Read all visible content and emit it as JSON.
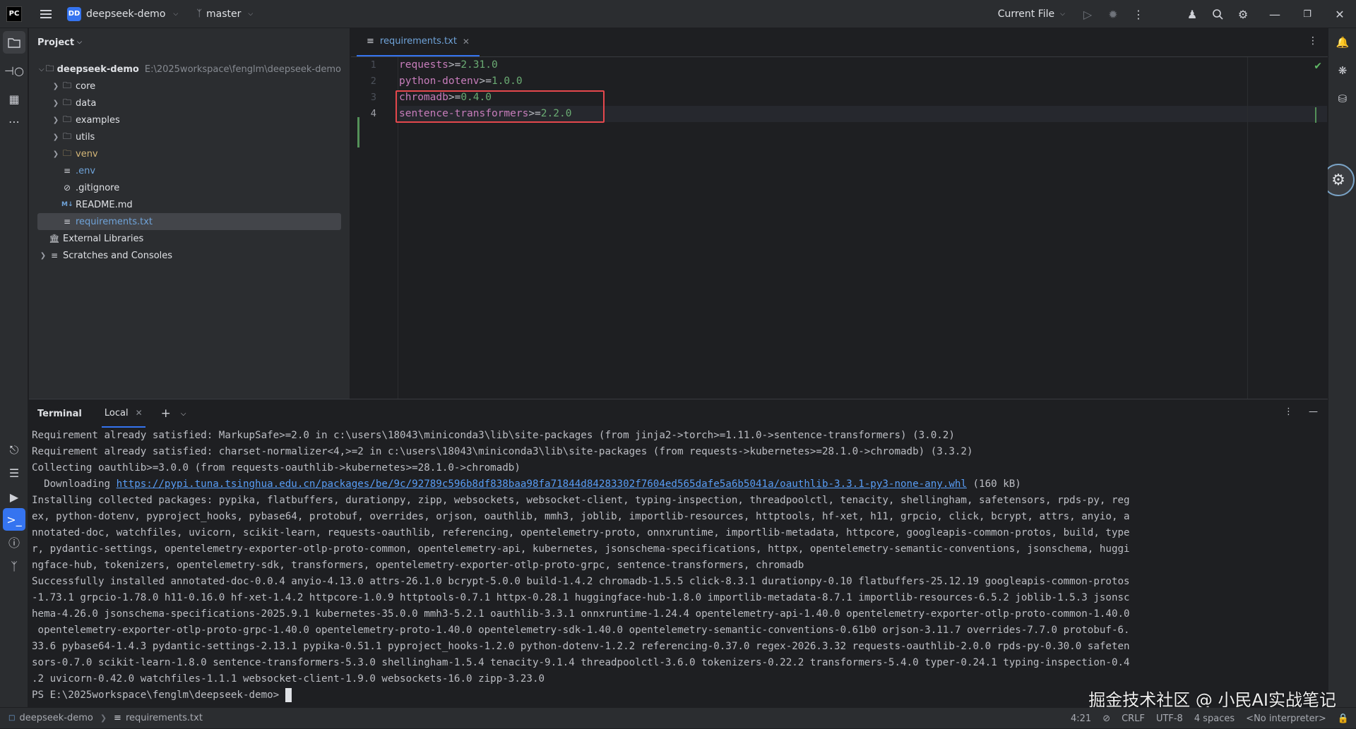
{
  "titlebar": {
    "logo": "PC",
    "project_badge": "DD",
    "project_name": "deepseek-demo",
    "branch": "master",
    "run_config": "Current File"
  },
  "project_panel": {
    "title": "Project",
    "root_name": "deepseek-demo",
    "root_path": "E:\\2025workspace\\fenglm\\deepseek-demo",
    "items": [
      {
        "label": "core"
      },
      {
        "label": "data"
      },
      {
        "label": "examples"
      },
      {
        "label": "utils"
      },
      {
        "label": "venv"
      },
      {
        "label": ".env"
      },
      {
        "label": ".gitignore"
      },
      {
        "label": "README.md"
      },
      {
        "label": "requirements.txt"
      },
      {
        "label": "External Libraries"
      },
      {
        "label": "Scratches and Consoles"
      }
    ]
  },
  "editor": {
    "tab_label": "requirements.txt",
    "line_numbers": [
      "1",
      "2",
      "3",
      "4"
    ],
    "lines": [
      {
        "name": "requests",
        "op": ">=",
        "ver": "2.31.0"
      },
      {
        "name": "python-dotenv",
        "op": ">=",
        "ver": "1.0.0"
      },
      {
        "name": "chromadb",
        "op": ">=",
        "ver": "0.4.0"
      },
      {
        "name": "sentence-transformers",
        "op": ">=",
        "ver": "2.2.0"
      }
    ]
  },
  "terminal": {
    "title": "Terminal",
    "tab_label": "Local",
    "lines": [
      "Requirement already satisfied: MarkupSafe>=2.0 in c:\\users\\18043\\miniconda3\\lib\\site-packages (from jinja2->torch>=1.11.0->sentence-transformers) (3.0.2)",
      "Requirement already satisfied: charset-normalizer<4,>=2 in c:\\users\\18043\\miniconda3\\lib\\site-packages (from requests->kubernetes>=28.1.0->chromadb) (3.3.2)",
      "Collecting oauthlib>=3.0.0 (from requests-oauthlib->kubernetes>=28.1.0->chromadb)"
    ],
    "download_prefix": "  Downloading ",
    "download_url": "https://pypi.tuna.tsinghua.edu.cn/packages/be/9c/92789c596b8df838baa98fa71844d84283302f7604ed565dafe5a6b5041a/oauthlib-3.3.1-py3-none-any.whl",
    "download_suffix": " (160 kB)",
    "lines2": [
      "Installing collected packages: pypika, flatbuffers, durationpy, zipp, websockets, websocket-client, typing-inspection, threadpoolctl, tenacity, shellingham, safetensors, rpds-py, reg",
      "ex, python-dotenv, pyproject_hooks, pybase64, protobuf, overrides, orjson, oauthlib, mmh3, joblib, importlib-resources, httptools, hf-xet, h11, grpcio, click, bcrypt, attrs, anyio, a",
      "nnotated-doc, watchfiles, uvicorn, scikit-learn, requests-oauthlib, referencing, opentelemetry-proto, onnxruntime, importlib-metadata, httpcore, googleapis-common-protos, build, type",
      "r, pydantic-settings, opentelemetry-exporter-otlp-proto-common, opentelemetry-api, kubernetes, jsonschema-specifications, httpx, opentelemetry-semantic-conventions, jsonschema, huggi",
      "ngface-hub, tokenizers, opentelemetry-sdk, transformers, opentelemetry-exporter-otlp-proto-grpc, sentence-transformers, chromadb",
      "Successfully installed annotated-doc-0.0.4 anyio-4.13.0 attrs-26.1.0 bcrypt-5.0.0 build-1.4.2 chromadb-1.5.5 click-8.3.1 durationpy-0.10 flatbuffers-25.12.19 googleapis-common-protos",
      "-1.73.1 grpcio-1.78.0 h11-0.16.0 hf-xet-1.4.2 httpcore-1.0.9 httptools-0.7.1 httpx-0.28.1 huggingface-hub-1.8.0 importlib-metadata-8.7.1 importlib-resources-6.5.2 joblib-1.5.3 jsonsc",
      "hema-4.26.0 jsonschema-specifications-2025.9.1 kubernetes-35.0.0 mmh3-5.2.1 oauthlib-3.3.1 onnxruntime-1.24.4 opentelemetry-api-1.40.0 opentelemetry-exporter-otlp-proto-common-1.40.0",
      " opentelemetry-exporter-otlp-proto-grpc-1.40.0 opentelemetry-proto-1.40.0 opentelemetry-sdk-1.40.0 opentelemetry-semantic-conventions-0.61b0 orjson-3.11.7 overrides-7.7.0 protobuf-6.",
      "33.6 pybase64-1.4.3 pydantic-settings-2.13.1 pypika-0.51.1 pyproject_hooks-1.2.0 python-dotenv-1.2.2 referencing-0.37.0 regex-2026.3.32 requests-oauthlib-2.0.0 rpds-py-0.30.0 safeten",
      "sors-0.7.0 scikit-learn-1.8.0 sentence-transformers-5.3.0 shellingham-1.5.4 tenacity-9.1.4 threadpoolctl-3.6.0 tokenizers-0.22.2 transformers-5.4.0 typer-0.24.1 typing-inspection-0.4",
      ".2 uvicorn-0.42.0 watchfiles-1.1.1 websocket-client-1.9.0 websockets-16.0 zipp-3.23.0"
    ],
    "prompt": "PS E:\\2025workspace\\fenglm\\deepseek-demo> "
  },
  "watermark": "掘金技术社区 @ 小民AI实战笔记",
  "statusbar": {
    "project": "deepseek-demo",
    "file": "requirements.txt",
    "position": "4:21",
    "line_sep": "CRLF",
    "encoding": "UTF-8",
    "indent": "4 spaces",
    "interpreter": "<No interpreter>"
  },
  "colors": {
    "accent": "#3574f0",
    "highlight_box": "#e5484d",
    "vcs_added": "#549159"
  }
}
